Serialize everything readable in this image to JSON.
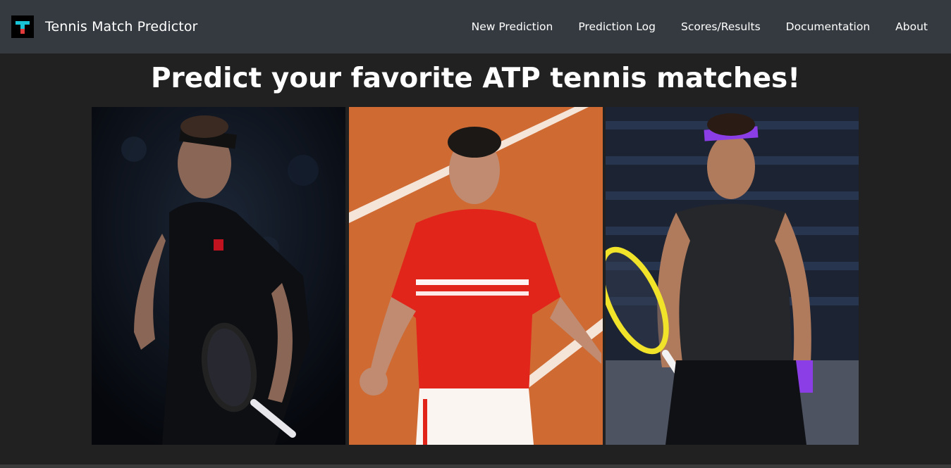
{
  "navbar": {
    "brand_title": "Tennis Match Predictor",
    "logo_letter": "T",
    "links": [
      {
        "label": "New Prediction"
      },
      {
        "label": "Prediction Log"
      },
      {
        "label": "Scores/Results"
      },
      {
        "label": "Documentation"
      },
      {
        "label": "About"
      }
    ]
  },
  "hero": {
    "headline": "Predict your favorite ATP tennis matches!"
  },
  "gallery": {
    "photos": [
      {
        "icon": "player-photo-dark-arena"
      },
      {
        "icon": "player-photo-clay-court"
      },
      {
        "icon": "player-photo-stadium-crowd"
      }
    ]
  },
  "colors": {
    "navbar_bg": "#343a40",
    "page_bg": "#212121",
    "clay": "#cf6a33",
    "logo_cyan": "#19c3d6",
    "logo_red": "#e23a3a"
  }
}
